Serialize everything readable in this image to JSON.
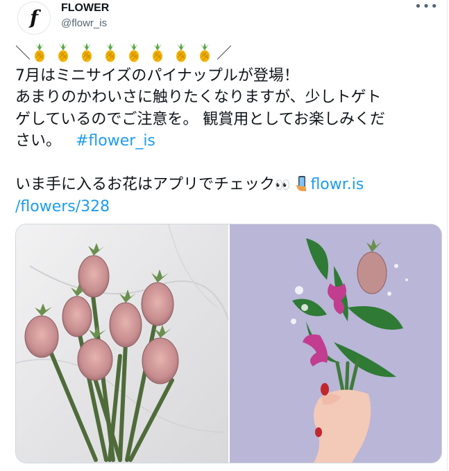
{
  "user": {
    "display_name": "FLOWER",
    "handle": "@flowr_is",
    "avatar_letter": "f"
  },
  "more_label": "•••",
  "tweet": {
    "line1_left": "＼",
    "line1_right": "／",
    "pineapple_count": 8,
    "line2": "7月はミニサイズのパイナップルが登場！",
    "line3": "あまりのかわいさに触りたくなりますが、少しトゲト",
    "line4": "ゲしているのでご注意を。 観賞用としてお楽しみくだ",
    "line5_text": "さい。",
    "hashtag": "#flower_is",
    "line6_text": "いま手に入るお花はアプリでチェック",
    "eyes_emoji": "👀",
    "link_part1": "flowr.is",
    "link_part2": "/flowers/328"
  },
  "media": {
    "left_image": "mini pineapples bouquet on marble",
    "right_image": "hand holding orchid and pineapple bouquet"
  },
  "colors": {
    "link": "#1d9bf0",
    "secondary_text": "#536471",
    "border": "#cfd9de"
  }
}
